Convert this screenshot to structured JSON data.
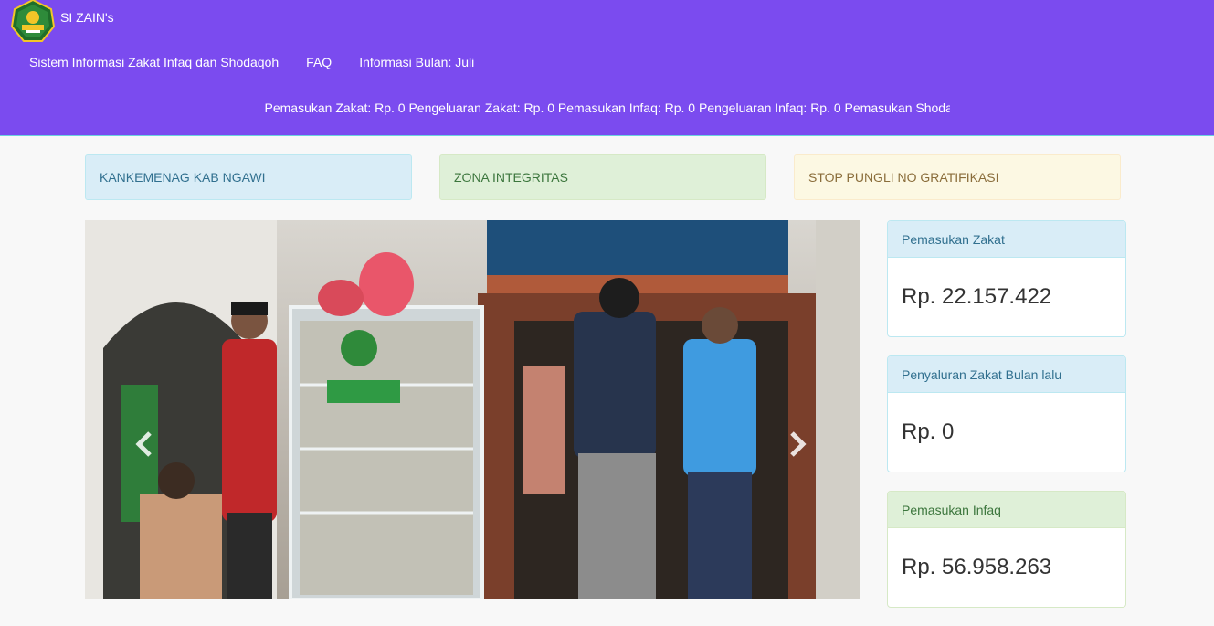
{
  "header": {
    "brand": "SI ZAIN's",
    "nav": [
      "Sistem Informasi Zakat Infaq dan Shodaqoh",
      "FAQ",
      "Informasi Bulan: Juli"
    ],
    "marquee": "Pemasukan Zakat: Rp. 0 Pengeluaran Zakat: Rp. 0 Pemasukan Infaq: Rp. 0 Pengeluaran Infaq: Rp. 0 Pemasukan Shoda"
  },
  "alerts": [
    {
      "text": "KANKEMENAG KAB NGAWI",
      "style": "info"
    },
    {
      "text": "ZONA INTEGRITAS",
      "style": "success"
    },
    {
      "text": "STOP PUNGLI NO GRATIFIKASI",
      "style": "warning"
    }
  ],
  "carousel": {
    "left_icon": "chevron-left-icon",
    "right_icon": "chevron-right-icon"
  },
  "panels": [
    {
      "title": "Pemasukan Zakat",
      "value": "Rp. 22.157.422",
      "style": "info"
    },
    {
      "title": "Penyaluran Zakat Bulan lalu",
      "value": "Rp. 0",
      "style": "info"
    },
    {
      "title": "Pemasukan Infaq",
      "value": "Rp. 56.958.263",
      "style": "success"
    }
  ],
  "colors": {
    "navbar": "#7b4bef",
    "info": "#d9edf7",
    "success": "#dff0d8",
    "warning": "#fcf8e3"
  }
}
